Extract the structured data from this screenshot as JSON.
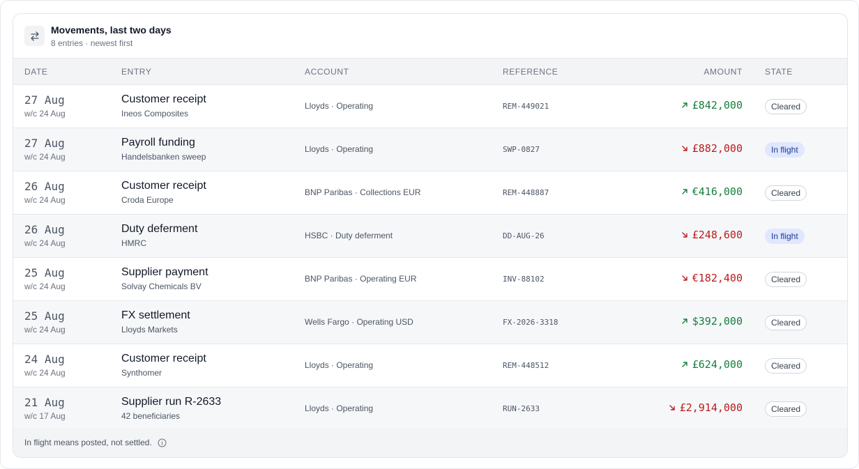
{
  "header": {
    "title": "Movements, last two days",
    "subtitle": "8 entries · newest first",
    "icon": "swap-arrows-icon"
  },
  "columns": {
    "date": "Date",
    "entry": "Entry",
    "account": "Account",
    "reference": "Reference",
    "amount": "Amount",
    "state": "State"
  },
  "colors": {
    "incoming": "#15803d",
    "outgoing": "#b91c1c",
    "inflight_badge_bg": "#e0e7ff"
  },
  "rows": [
    {
      "date": "27 Aug",
      "week": "w/c 24 Aug",
      "entry": "Customer receipt",
      "counterparty": "Ineos Composites",
      "account": "Lloyds · Operating",
      "reference": "REM-449021",
      "direction": "in",
      "amount": "£842,000",
      "state": "Cleared"
    },
    {
      "date": "27 Aug",
      "week": "w/c 24 Aug",
      "entry": "Payroll funding",
      "counterparty": "Handelsbanken sweep",
      "account": "Lloyds · Operating",
      "reference": "SWP-0827",
      "direction": "out",
      "amount": "£882,000",
      "state": "In flight"
    },
    {
      "date": "26 Aug",
      "week": "w/c 24 Aug",
      "entry": "Customer receipt",
      "counterparty": "Croda Europe",
      "account": "BNP Paribas · Collections EUR",
      "reference": "REM-448887",
      "direction": "in",
      "amount": "€416,000",
      "state": "Cleared"
    },
    {
      "date": "26 Aug",
      "week": "w/c 24 Aug",
      "entry": "Duty deferment",
      "counterparty": "HMRC",
      "account": "HSBC · Duty deferment",
      "reference": "DD-AUG-26",
      "direction": "out",
      "amount": "£248,600",
      "state": "In flight"
    },
    {
      "date": "25 Aug",
      "week": "w/c 24 Aug",
      "entry": "Supplier payment",
      "counterparty": "Solvay Chemicals BV",
      "account": "BNP Paribas · Operating EUR",
      "reference": "INV-88102",
      "direction": "out",
      "amount": "€182,400",
      "state": "Cleared"
    },
    {
      "date": "25 Aug",
      "week": "w/c 24 Aug",
      "entry": "FX settlement",
      "counterparty": "Lloyds Markets",
      "account": "Wells Fargo · Operating USD",
      "reference": "FX-2026-3318",
      "direction": "in",
      "amount": "$392,000",
      "state": "Cleared"
    },
    {
      "date": "24 Aug",
      "week": "w/c 24 Aug",
      "entry": "Customer receipt",
      "counterparty": "Synthomer",
      "account": "Lloyds · Operating",
      "reference": "REM-448512",
      "direction": "in",
      "amount": "£624,000",
      "state": "Cleared"
    },
    {
      "date": "21 Aug",
      "week": "w/c 17 Aug",
      "entry": "Supplier run R-2633",
      "counterparty": "42 beneficiaries",
      "account": "Lloyds · Operating",
      "reference": "RUN-2633",
      "direction": "out",
      "amount": "£2,914,000",
      "state": "Cleared"
    }
  ],
  "footer": {
    "note": "In flight means posted, not settled.",
    "icon": "info-icon"
  }
}
